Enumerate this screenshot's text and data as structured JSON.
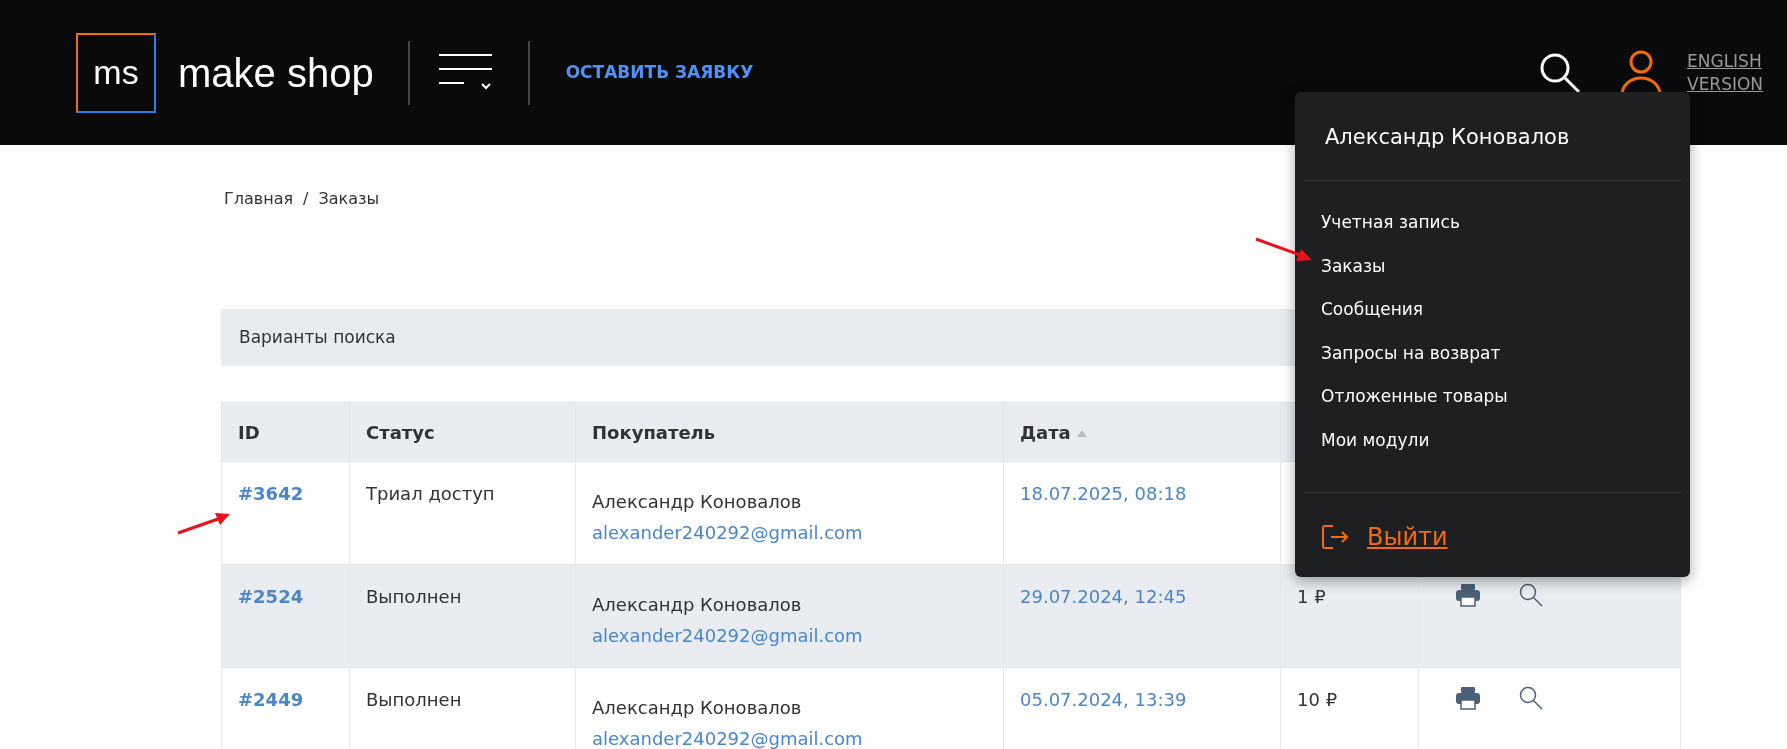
{
  "header": {
    "logo_mark": "ms",
    "logo_text": "make shop",
    "cta": "ОСТАВИТЬ ЗАЯВКУ",
    "language_link": "ENGLISH VERSION"
  },
  "breadcrumb": {
    "items": [
      "Главная",
      "Заказы"
    ],
    "separator": "/"
  },
  "search_panel": {
    "title": "Варианты поиска"
  },
  "table": {
    "columns": [
      {
        "label": "ID",
        "sorted": false
      },
      {
        "label": "Статус",
        "sorted": false
      },
      {
        "label": "Покупатель",
        "sorted": false
      },
      {
        "label": "Дата",
        "sorted": true
      }
    ],
    "rows": [
      {
        "id": "#3642",
        "status": "Триал доступ",
        "buyer_name": "Александр Коновалов",
        "buyer_email": "alexander240292@gmail.com",
        "date": "18.07.2025, 08:18"
      },
      {
        "id": "#2524",
        "status": "Выполнен",
        "buyer_name": "Александр Коновалов",
        "buyer_email": "alexander240292@gmail.com",
        "date": "29.07.2024, 12:45",
        "amount": "1 ₽"
      },
      {
        "id": "#2449",
        "status": "Выполнен",
        "buyer_name": "Александр Коновалов",
        "buyer_email": "alexander240292@gmail.com",
        "date": "05.07.2024, 13:39",
        "amount": "10 ₽"
      }
    ]
  },
  "user_menu": {
    "name": "Александр Коновалов",
    "items": [
      "Учетная запись",
      "Заказы",
      "Сообщения",
      "Запросы на возврат",
      "Отложенные товары",
      "Мои модули"
    ],
    "logout": "Выйти"
  }
}
